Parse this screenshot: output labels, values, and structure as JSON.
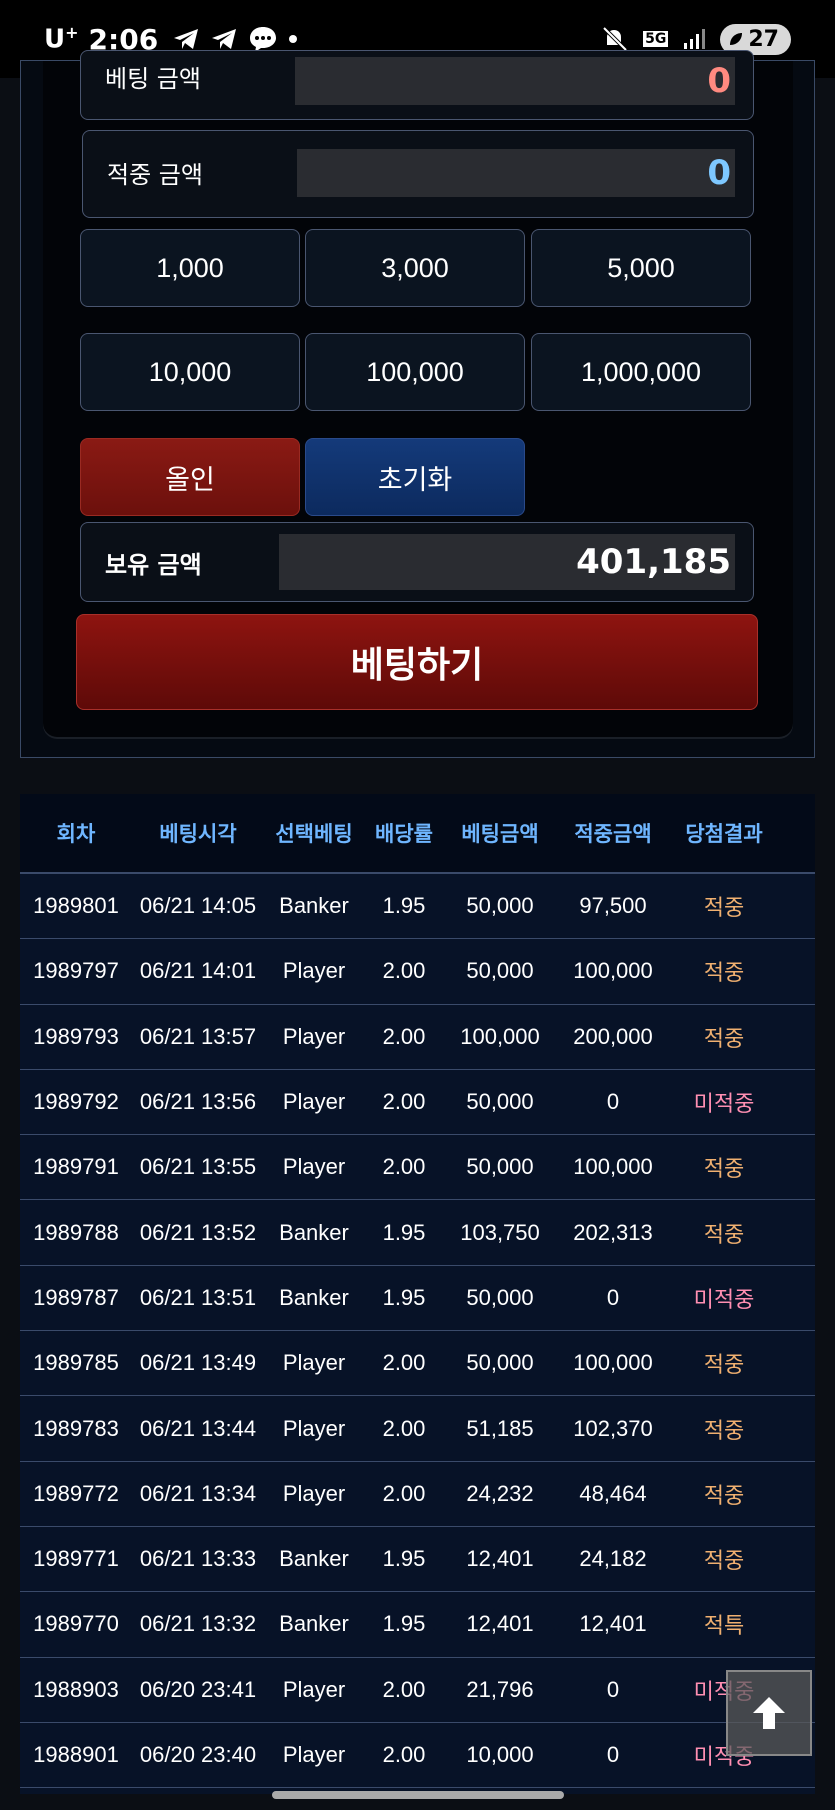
{
  "status": {
    "carrier": "U",
    "carrier_sup": "+",
    "time": "2:06",
    "network": "5G",
    "battery": "27"
  },
  "bet_panel": {
    "bet_amount_label": "베팅 금액",
    "bet_amount_value": "0",
    "win_amount_label": "적중 금액",
    "win_amount_value": "0",
    "chips_row1": [
      "1,000",
      "3,000",
      "5,000"
    ],
    "chips_row2": [
      "10,000",
      "100,000",
      "1,000,000"
    ],
    "allin_label": "올인",
    "reset_label": "초기화",
    "balance_label": "보유 금액",
    "balance_value": "401,185",
    "bet_button_label": "베팅하기"
  },
  "history": {
    "headers": [
      "회차",
      "베팅시각",
      "선택베팅",
      "배당률",
      "베팅금액",
      "적중금액",
      "당첨결과"
    ],
    "rows": [
      {
        "round": "1989801",
        "time": "06/21 14:05",
        "pick": "Banker",
        "odds": "1.95",
        "bet": "50,000",
        "win": "97,500",
        "result": "적중",
        "status": "win"
      },
      {
        "round": "1989797",
        "time": "06/21 14:01",
        "pick": "Player",
        "odds": "2.00",
        "bet": "50,000",
        "win": "100,000",
        "result": "적중",
        "status": "win"
      },
      {
        "round": "1989793",
        "time": "06/21 13:57",
        "pick": "Player",
        "odds": "2.00",
        "bet": "100,000",
        "win": "200,000",
        "result": "적중",
        "status": "win"
      },
      {
        "round": "1989792",
        "time": "06/21 13:56",
        "pick": "Player",
        "odds": "2.00",
        "bet": "50,000",
        "win": "0",
        "result": "미적중",
        "status": "lose"
      },
      {
        "round": "1989791",
        "time": "06/21 13:55",
        "pick": "Player",
        "odds": "2.00",
        "bet": "50,000",
        "win": "100,000",
        "result": "적중",
        "status": "win"
      },
      {
        "round": "1989788",
        "time": "06/21 13:52",
        "pick": "Banker",
        "odds": "1.95",
        "bet": "103,750",
        "win": "202,313",
        "result": "적중",
        "status": "win"
      },
      {
        "round": "1989787",
        "time": "06/21 13:51",
        "pick": "Banker",
        "odds": "1.95",
        "bet": "50,000",
        "win": "0",
        "result": "미적중",
        "status": "lose"
      },
      {
        "round": "1989785",
        "time": "06/21 13:49",
        "pick": "Player",
        "odds": "2.00",
        "bet": "50,000",
        "win": "100,000",
        "result": "적중",
        "status": "win"
      },
      {
        "round": "1989783",
        "time": "06/21 13:44",
        "pick": "Player",
        "odds": "2.00",
        "bet": "51,185",
        "win": "102,370",
        "result": "적중",
        "status": "win"
      },
      {
        "round": "1989772",
        "time": "06/21 13:34",
        "pick": "Player",
        "odds": "2.00",
        "bet": "24,232",
        "win": "48,464",
        "result": "적중",
        "status": "win"
      },
      {
        "round": "1989771",
        "time": "06/21 13:33",
        "pick": "Banker",
        "odds": "1.95",
        "bet": "12,401",
        "win": "24,182",
        "result": "적중",
        "status": "win"
      },
      {
        "round": "1989770",
        "time": "06/21 13:32",
        "pick": "Banker",
        "odds": "1.95",
        "bet": "12,401",
        "win": "12,401",
        "result": "적특",
        "status": "win"
      },
      {
        "round": "1988903",
        "time": "06/20 23:41",
        "pick": "Player",
        "odds": "2.00",
        "bet": "21,796",
        "win": "0",
        "result": "미적중",
        "status": "lose"
      },
      {
        "round": "1988901",
        "time": "06/20 23:40",
        "pick": "Player",
        "odds": "2.00",
        "bet": "10,000",
        "win": "0",
        "result": "미적중",
        "status": "lose"
      }
    ]
  },
  "colors": {
    "win": "#f0b070",
    "lose": "#ff8fb2",
    "header_text": "#6fb6ff",
    "bet_value": "#ff8a80",
    "win_value": "#7ec8ff"
  },
  "icons": {
    "scroll_top": "arrow-up-icon"
  }
}
